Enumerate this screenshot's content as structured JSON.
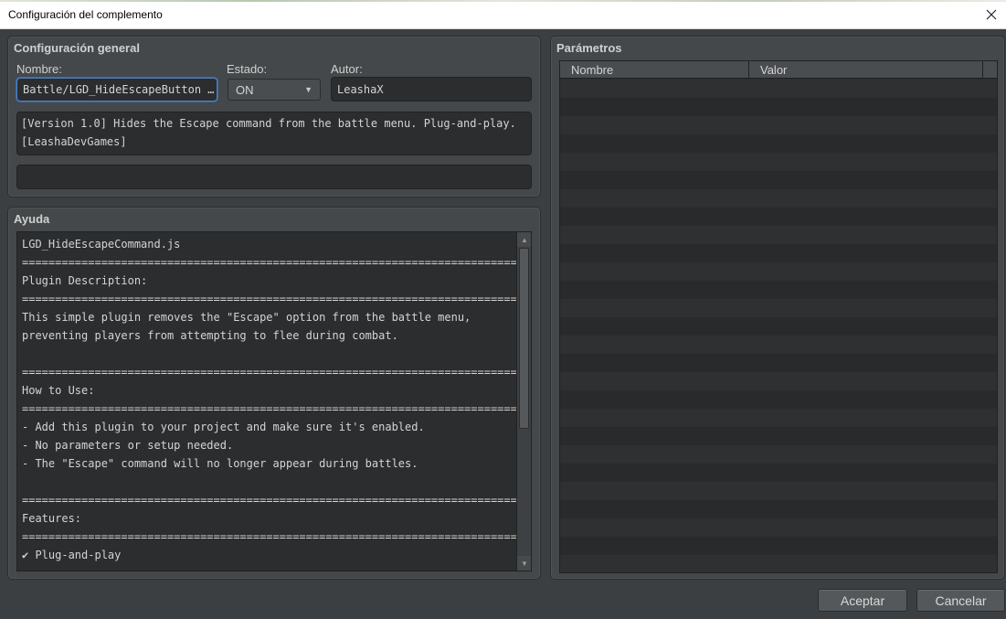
{
  "window": {
    "title": "Configuración del complemento"
  },
  "general": {
    "title": "Configuración general",
    "name_label": "Nombre:",
    "name_value": "Battle/LGD_HideEscapeButton …",
    "status_label": "Estado:",
    "status_value": "ON",
    "author_label": "Autor:",
    "author_value": "LeashaX",
    "description": "[Version 1.0] Hides the Escape command from the battle menu. Plug-and-play.\n[LeashaDevGames]",
    "extra_value": ""
  },
  "help": {
    "title": "Ayuda",
    "text": "LGD_HideEscapeCommand.js\n============================================================================\nPlugin Description:\n============================================================================\nThis simple plugin removes the \"Escape\" option from the battle menu,\npreventing players from attempting to flee during combat.\n\n============================================================================\nHow to Use:\n============================================================================\n- Add this plugin to your project and make sure it's enabled.\n- No parameters or setup needed.\n- The \"Escape\" command will no longer appear during battles.\n\n============================================================================\nFeatures:\n============================================================================\n✔ Plug-and-play"
  },
  "params": {
    "title": "Parámetros",
    "col_name": "Nombre",
    "col_value": "Valor"
  },
  "buttons": {
    "ok": "Aceptar",
    "cancel": "Cancelar"
  },
  "icons": {
    "close": "close-icon",
    "dropdown": "chevron-down-icon",
    "scroll_up": "scroll-up-icon",
    "scroll_down": "scroll-down-icon"
  }
}
